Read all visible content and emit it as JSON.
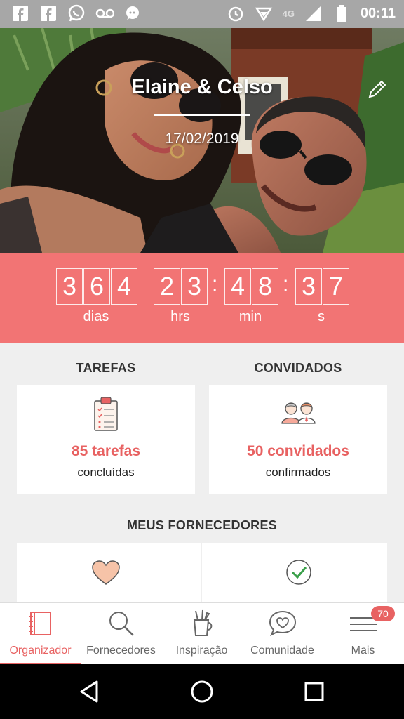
{
  "status_bar": {
    "network_label": "4G",
    "time": "00:11"
  },
  "hero": {
    "couple_name": "Elaine & Celso",
    "wedding_date": "17/02/2019"
  },
  "countdown": {
    "days_digits": [
      "3",
      "6",
      "4"
    ],
    "hours_digits": [
      "2",
      "3"
    ],
    "minutes_digits": [
      "4",
      "8"
    ],
    "seconds_digits": [
      "3",
      "7"
    ],
    "days_label": "dias",
    "hours_label": "hrs",
    "minutes_label": "min",
    "seconds_label": "s",
    "separator": ":"
  },
  "summary": {
    "tasks": {
      "title": "TAREFAS",
      "value": "85 tarefas",
      "caption": "concluídas"
    },
    "guests": {
      "title": "CONVIDADOS",
      "value": "50 convidados",
      "caption": "confirmados"
    }
  },
  "suppliers": {
    "title": "MEUS FORNECEDORES"
  },
  "bottom_nav": {
    "items": [
      {
        "label": "Organizador",
        "icon": "notebook-icon",
        "active": true
      },
      {
        "label": "Fornecedores",
        "icon": "search-icon",
        "active": false
      },
      {
        "label": "Inspiração",
        "icon": "brush-cup-icon",
        "active": false
      },
      {
        "label": "Comunidade",
        "icon": "chat-heart-icon",
        "active": false
      },
      {
        "label": "Mais",
        "icon": "menu-icon",
        "active": false
      }
    ],
    "more_badge": "70"
  },
  "colors": {
    "accent": "#e86262",
    "countdown_bg": "#f27474",
    "status_bar": "#a7a7a7"
  }
}
